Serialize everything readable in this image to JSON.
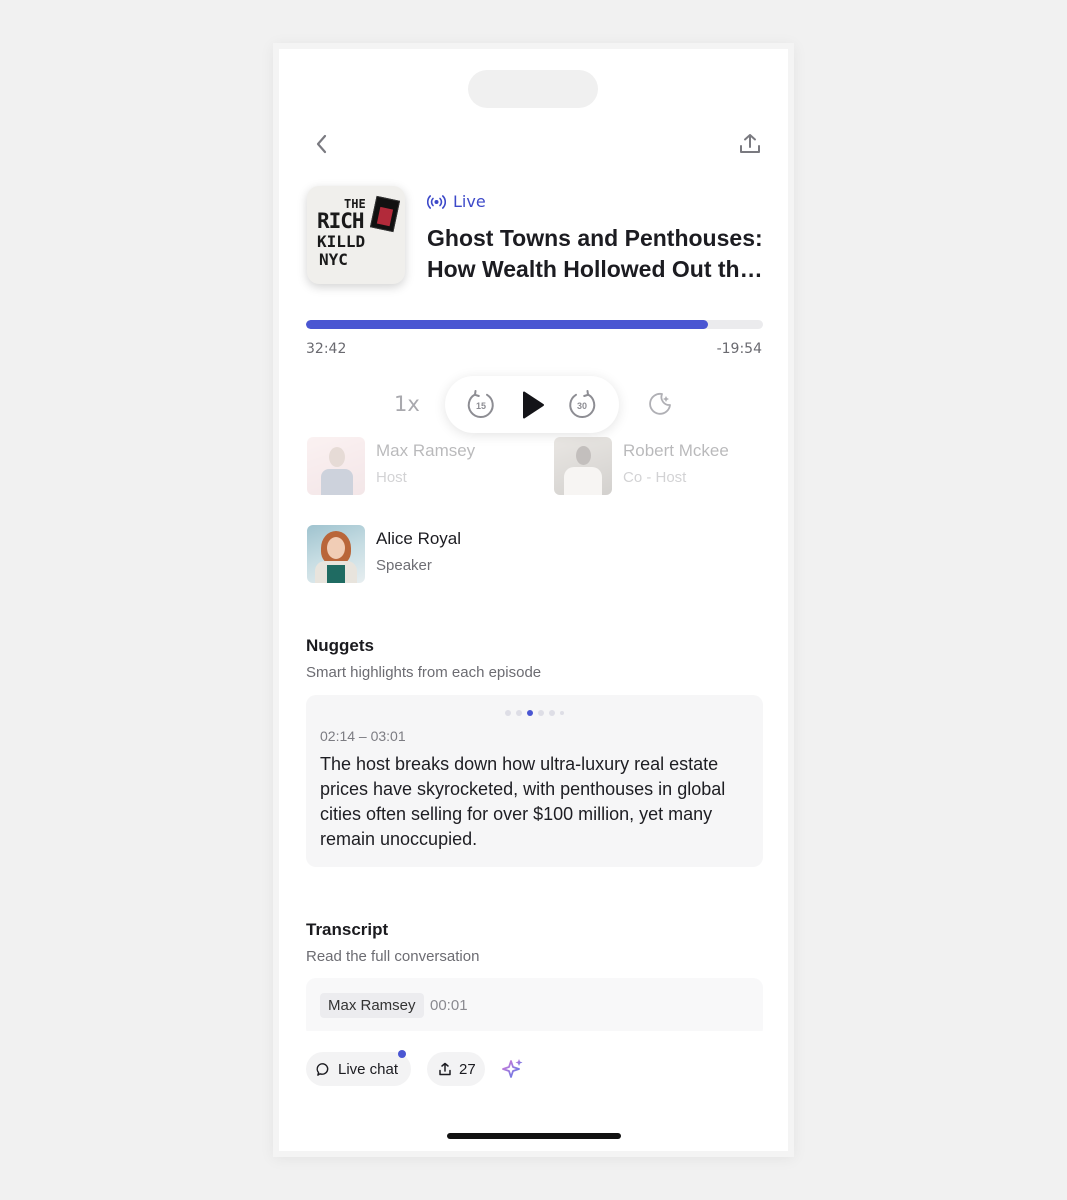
{
  "colors": {
    "accent": "#4a56d2",
    "live": "#3d49c9",
    "background": "#f1f1f1"
  },
  "header": {
    "back_icon": "chevron-left-icon",
    "share_icon": "share-icon"
  },
  "episode": {
    "cover_lines": [
      "THE",
      "RICH",
      "KILLD",
      "NYC"
    ],
    "live_label": "Live",
    "title_line1": "Ghost Towns and Penthouses:",
    "title_line2": "How Wealth Hollowed Out the City"
  },
  "player": {
    "progress": 0.88,
    "elapsed": "32:42",
    "remaining": "-19:54",
    "speed": "1x",
    "rewind_seconds": "15",
    "forward_seconds": "30"
  },
  "people": [
    {
      "name": "Max Ramsey",
      "role": "Host"
    },
    {
      "name": "Robert Mckee",
      "role": "Co - Host"
    },
    {
      "name": "Alice Royal",
      "role": "Speaker"
    }
  ],
  "nuggets": {
    "title": "Nuggets",
    "subtitle": "Smart highlights from each episode",
    "page_count": 6,
    "active_page": 3,
    "time_range": "02:14 – 03:01",
    "text": "The host breaks down how ultra-luxury real estate prices have skyrocketed, with penthouses in global cities often selling for over $100 million, yet many remain unoccupied."
  },
  "transcript": {
    "title": "Transcript",
    "subtitle": "Read the full conversation",
    "first_speaker": "Max Ramsey",
    "first_time": "00:01"
  },
  "bottom": {
    "live_chat_label": "Live chat",
    "share_count": "27"
  }
}
